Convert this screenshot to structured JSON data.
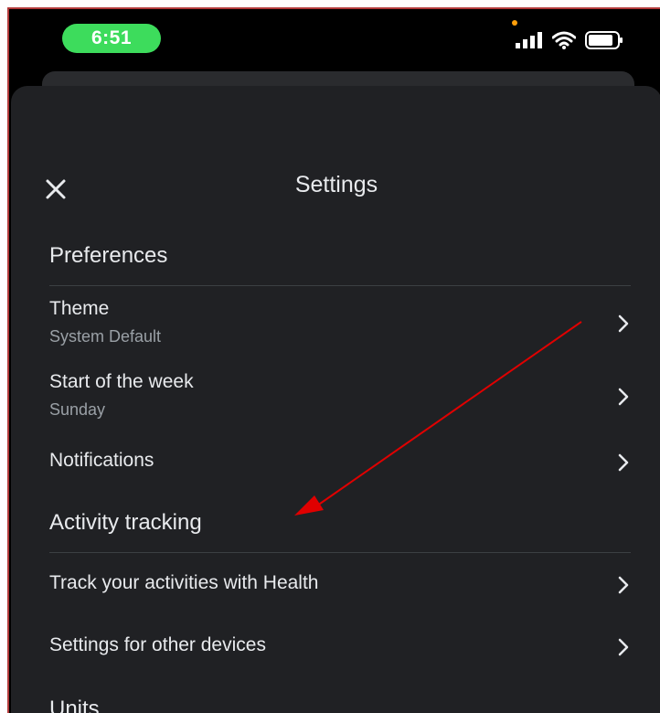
{
  "status_bar": {
    "time": "6:51"
  },
  "header": {
    "title": "Settings"
  },
  "sections": [
    {
      "header": "Preferences",
      "rows": [
        {
          "title": "Theme",
          "subtitle": "System Default"
        },
        {
          "title": "Start of the week",
          "subtitle": "Sunday"
        },
        {
          "title": "Notifications",
          "subtitle": ""
        }
      ]
    },
    {
      "header": "Activity tracking",
      "rows": [
        {
          "title": "Track your activities with Health",
          "subtitle": ""
        },
        {
          "title": "Settings for other devices",
          "subtitle": ""
        }
      ]
    },
    {
      "header": "Units",
      "rows": []
    }
  ],
  "icons": {
    "close": "close-icon",
    "chevron": "chevron-right-icon",
    "signal": "cellular-signal-icon",
    "wifi": "wifi-icon",
    "battery": "battery-icon"
  },
  "colors": {
    "panel_background": "#202124",
    "status_pill": "#3ddc5c",
    "annotation_arrow": "#e00000"
  }
}
